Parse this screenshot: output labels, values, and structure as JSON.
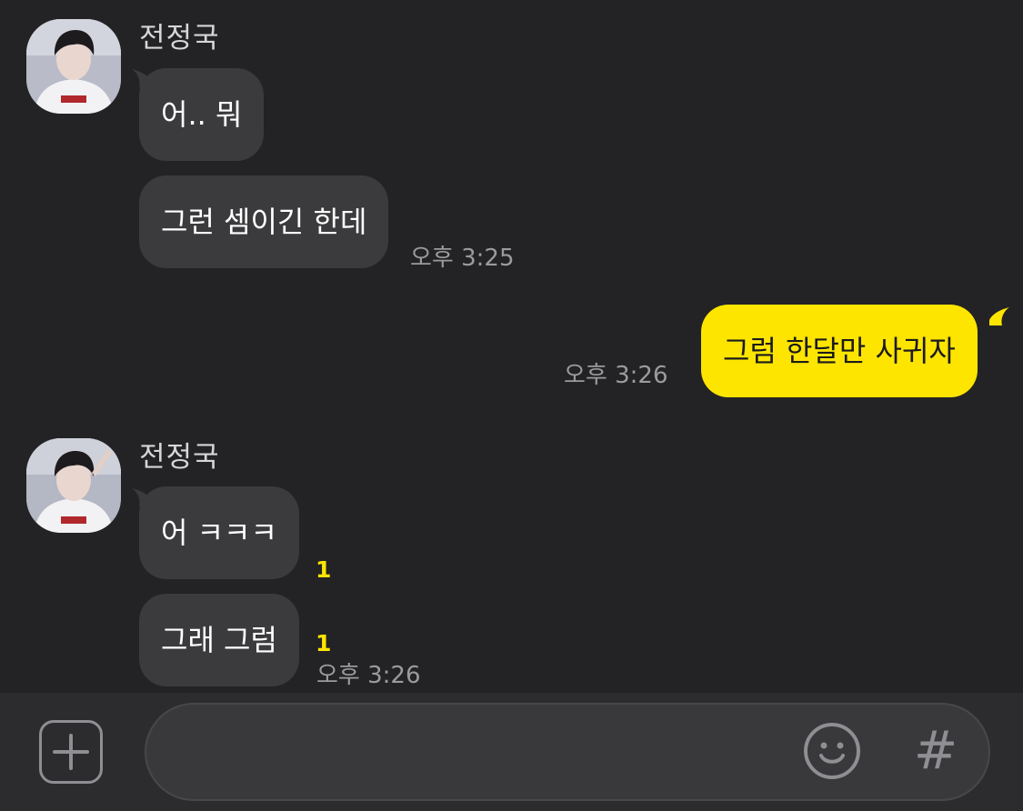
{
  "chat": {
    "groups": [
      {
        "sender": "전정국",
        "messages": [
          {
            "text": "어.. 뭐"
          },
          {
            "text": "그런 셈이긴 한데",
            "time": "오후 3:25"
          }
        ]
      },
      {
        "sender": "전정국",
        "messages": [
          {
            "text": "어 ㅋㅋㅋ",
            "unread": "1"
          },
          {
            "text": "그래 그럼",
            "unread": "1",
            "time": "오후 3:26"
          }
        ]
      }
    ],
    "my_message": {
      "text": "그럼 한달만 사귀자",
      "time": "오후 3:26"
    }
  },
  "colors": {
    "background": "#232325",
    "incoming_bubble": "#3b3b3d",
    "outgoing_bubble": "#fee500",
    "unread_count": "#fee500"
  },
  "input_bar": {
    "plus_icon": "plus-square-icon",
    "emoji_icon": "smiley-icon",
    "hash_label": "#"
  }
}
